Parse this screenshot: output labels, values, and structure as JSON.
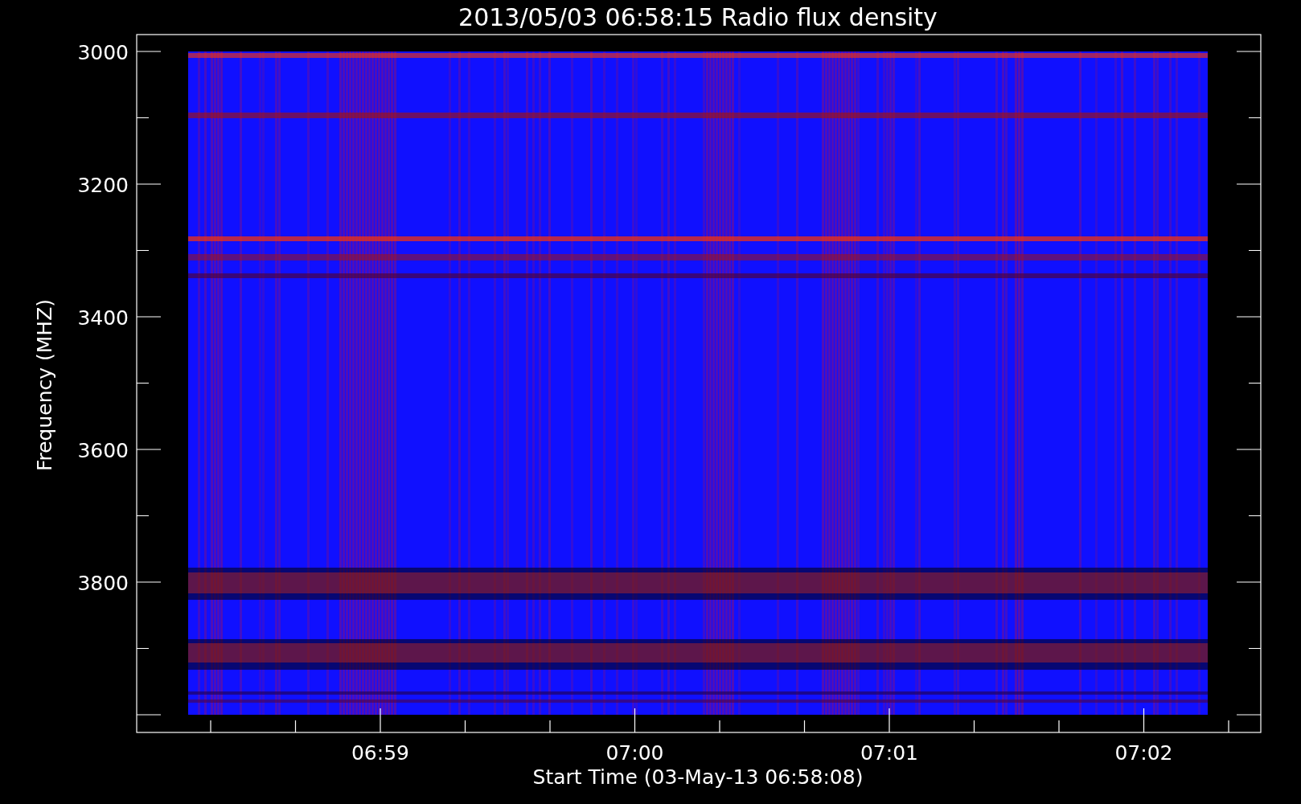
{
  "title": "2013/05/03 06:58:15 Radio flux density",
  "y_axis": {
    "label": "Frequency (MHZ)",
    "ticks": [
      "3000",
      "3200",
      "3400",
      "3600",
      "3800"
    ]
  },
  "x_axis": {
    "label": "Start Time (03-May-13 06:58:08)",
    "ticks": [
      "06:59",
      "07:00",
      "07:01",
      "07:02"
    ]
  }
}
